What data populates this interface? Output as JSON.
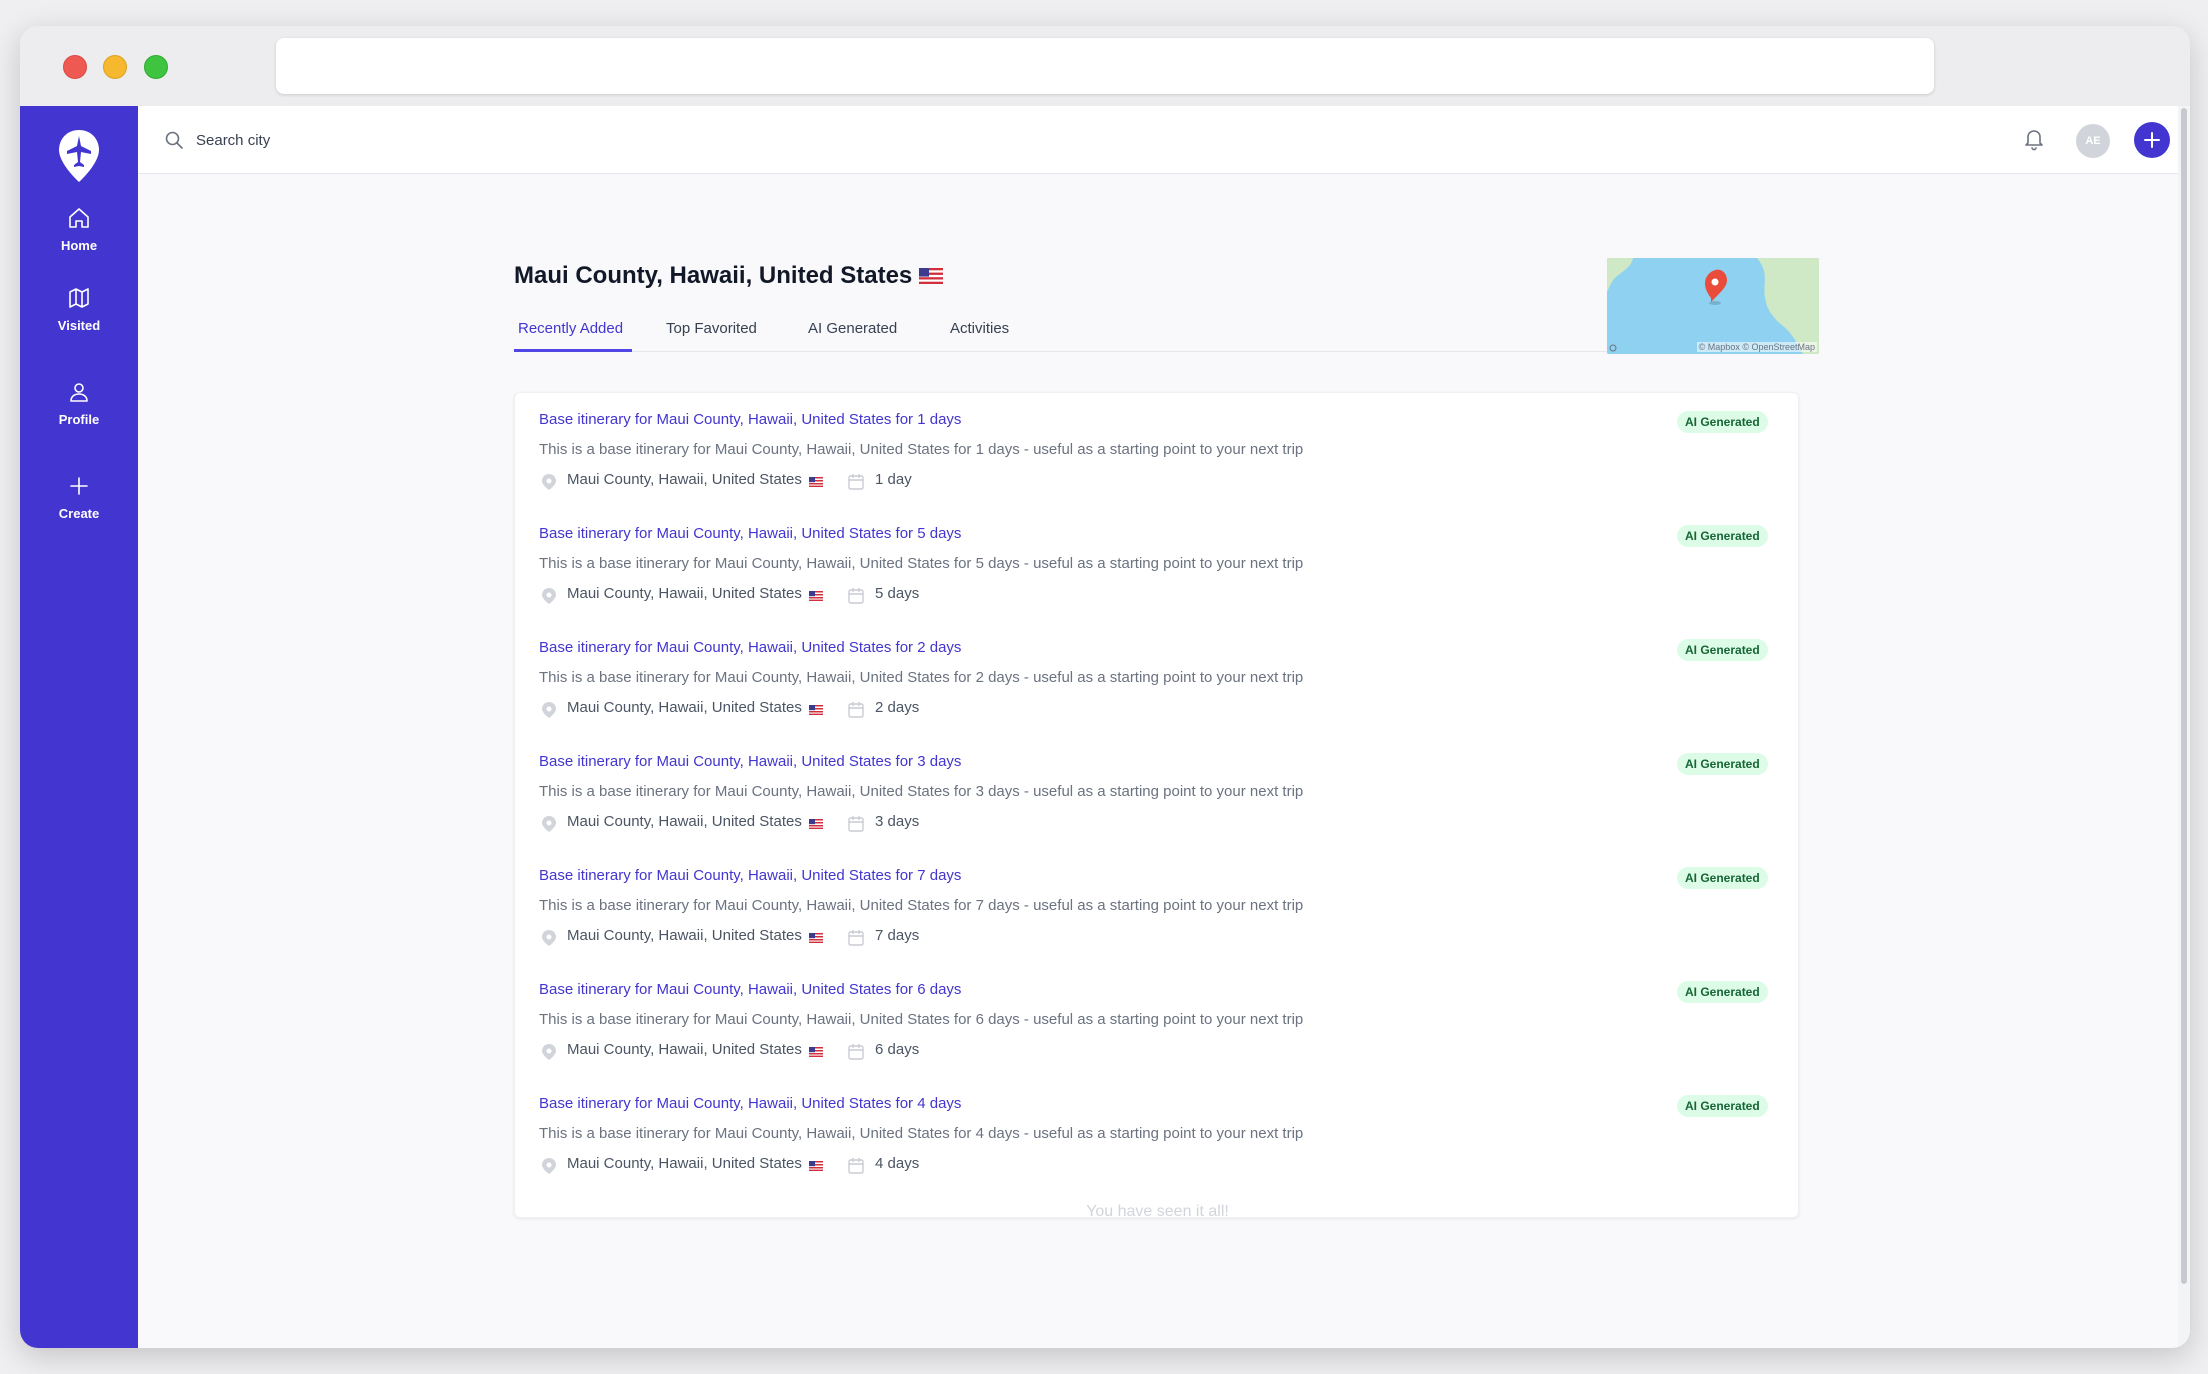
{
  "app": {
    "search": {
      "placeholder": "Search city"
    },
    "user": {
      "initials": "AE"
    },
    "colors": {
      "brand": "#4335cf",
      "badge_bg": "#dcfce7",
      "badge_text": "#166534"
    }
  },
  "sidebar": {
    "items": [
      {
        "label": "Home",
        "icon": "home-icon"
      },
      {
        "label": "Visited",
        "icon": "map-icon"
      },
      {
        "label": "Profile",
        "icon": "user-icon"
      },
      {
        "label": "Create",
        "icon": "plus-icon"
      }
    ]
  },
  "page": {
    "title": "Maui County, Hawaii, United States",
    "flag": "us-flag",
    "tabs": [
      "Recently Added",
      "Top Favorited",
      "AI Generated",
      "Activities"
    ],
    "active_tab": "Recently Added",
    "map_attribution": "© Mapbox © OpenStreetMap"
  },
  "itineraries": [
    {
      "title": "Base itinerary for Maui County, Hawaii, United States for 1 days",
      "description": "This is a base itinerary for Maui County, Hawaii, United States for 1 days - useful as a starting point to your next trip",
      "location": "Maui County, Hawaii, United States",
      "duration": "1 day",
      "badge": "AI Generated"
    },
    {
      "title": "Base itinerary for Maui County, Hawaii, United States for 5 days",
      "description": "This is a base itinerary for Maui County, Hawaii, United States for 5 days - useful as a starting point to your next trip",
      "location": "Maui County, Hawaii, United States",
      "duration": "5 days",
      "badge": "AI Generated"
    },
    {
      "title": "Base itinerary for Maui County, Hawaii, United States for 2 days",
      "description": "This is a base itinerary for Maui County, Hawaii, United States for 2 days - useful as a starting point to your next trip",
      "location": "Maui County, Hawaii, United States",
      "duration": "2 days",
      "badge": "AI Generated"
    },
    {
      "title": "Base itinerary for Maui County, Hawaii, United States for 3 days",
      "description": "This is a base itinerary for Maui County, Hawaii, United States for 3 days - useful as a starting point to your next trip",
      "location": "Maui County, Hawaii, United States",
      "duration": "3 days",
      "badge": "AI Generated"
    },
    {
      "title": "Base itinerary for Maui County, Hawaii, United States for 7 days",
      "description": "This is a base itinerary for Maui County, Hawaii, United States for 7 days - useful as a starting point to your next trip",
      "location": "Maui County, Hawaii, United States",
      "duration": "7 days",
      "badge": "AI Generated"
    },
    {
      "title": "Base itinerary for Maui County, Hawaii, United States for 6 days",
      "description": "This is a base itinerary for Maui County, Hawaii, United States for 6 days - useful as a starting point to your next trip",
      "location": "Maui County, Hawaii, United States",
      "duration": "6 days",
      "badge": "AI Generated"
    },
    {
      "title": "Base itinerary for Maui County, Hawaii, United States for 4 days",
      "description": "This is a base itinerary for Maui County, Hawaii, United States for 4 days - useful as a starting point to your next trip",
      "location": "Maui County, Hawaii, United States",
      "duration": "4 days",
      "badge": "AI Generated"
    }
  ],
  "end_message": "You have seen it all!"
}
